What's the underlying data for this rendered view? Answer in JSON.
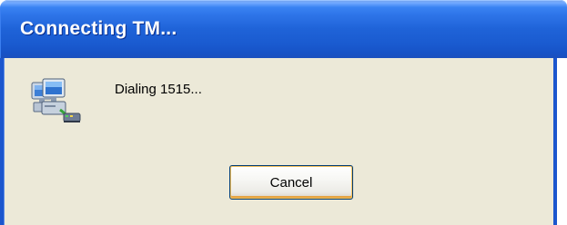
{
  "window": {
    "title": "Connecting TM...",
    "icon": "network-computers-icon"
  },
  "dialog": {
    "message": "Dialing 1515...",
    "cancel_label": "Cancel"
  },
  "colors": {
    "titlebar": "#245edb",
    "client_background": "#ece9d8",
    "frame": "#1b56cd",
    "button_focus": "#f6c15b"
  }
}
